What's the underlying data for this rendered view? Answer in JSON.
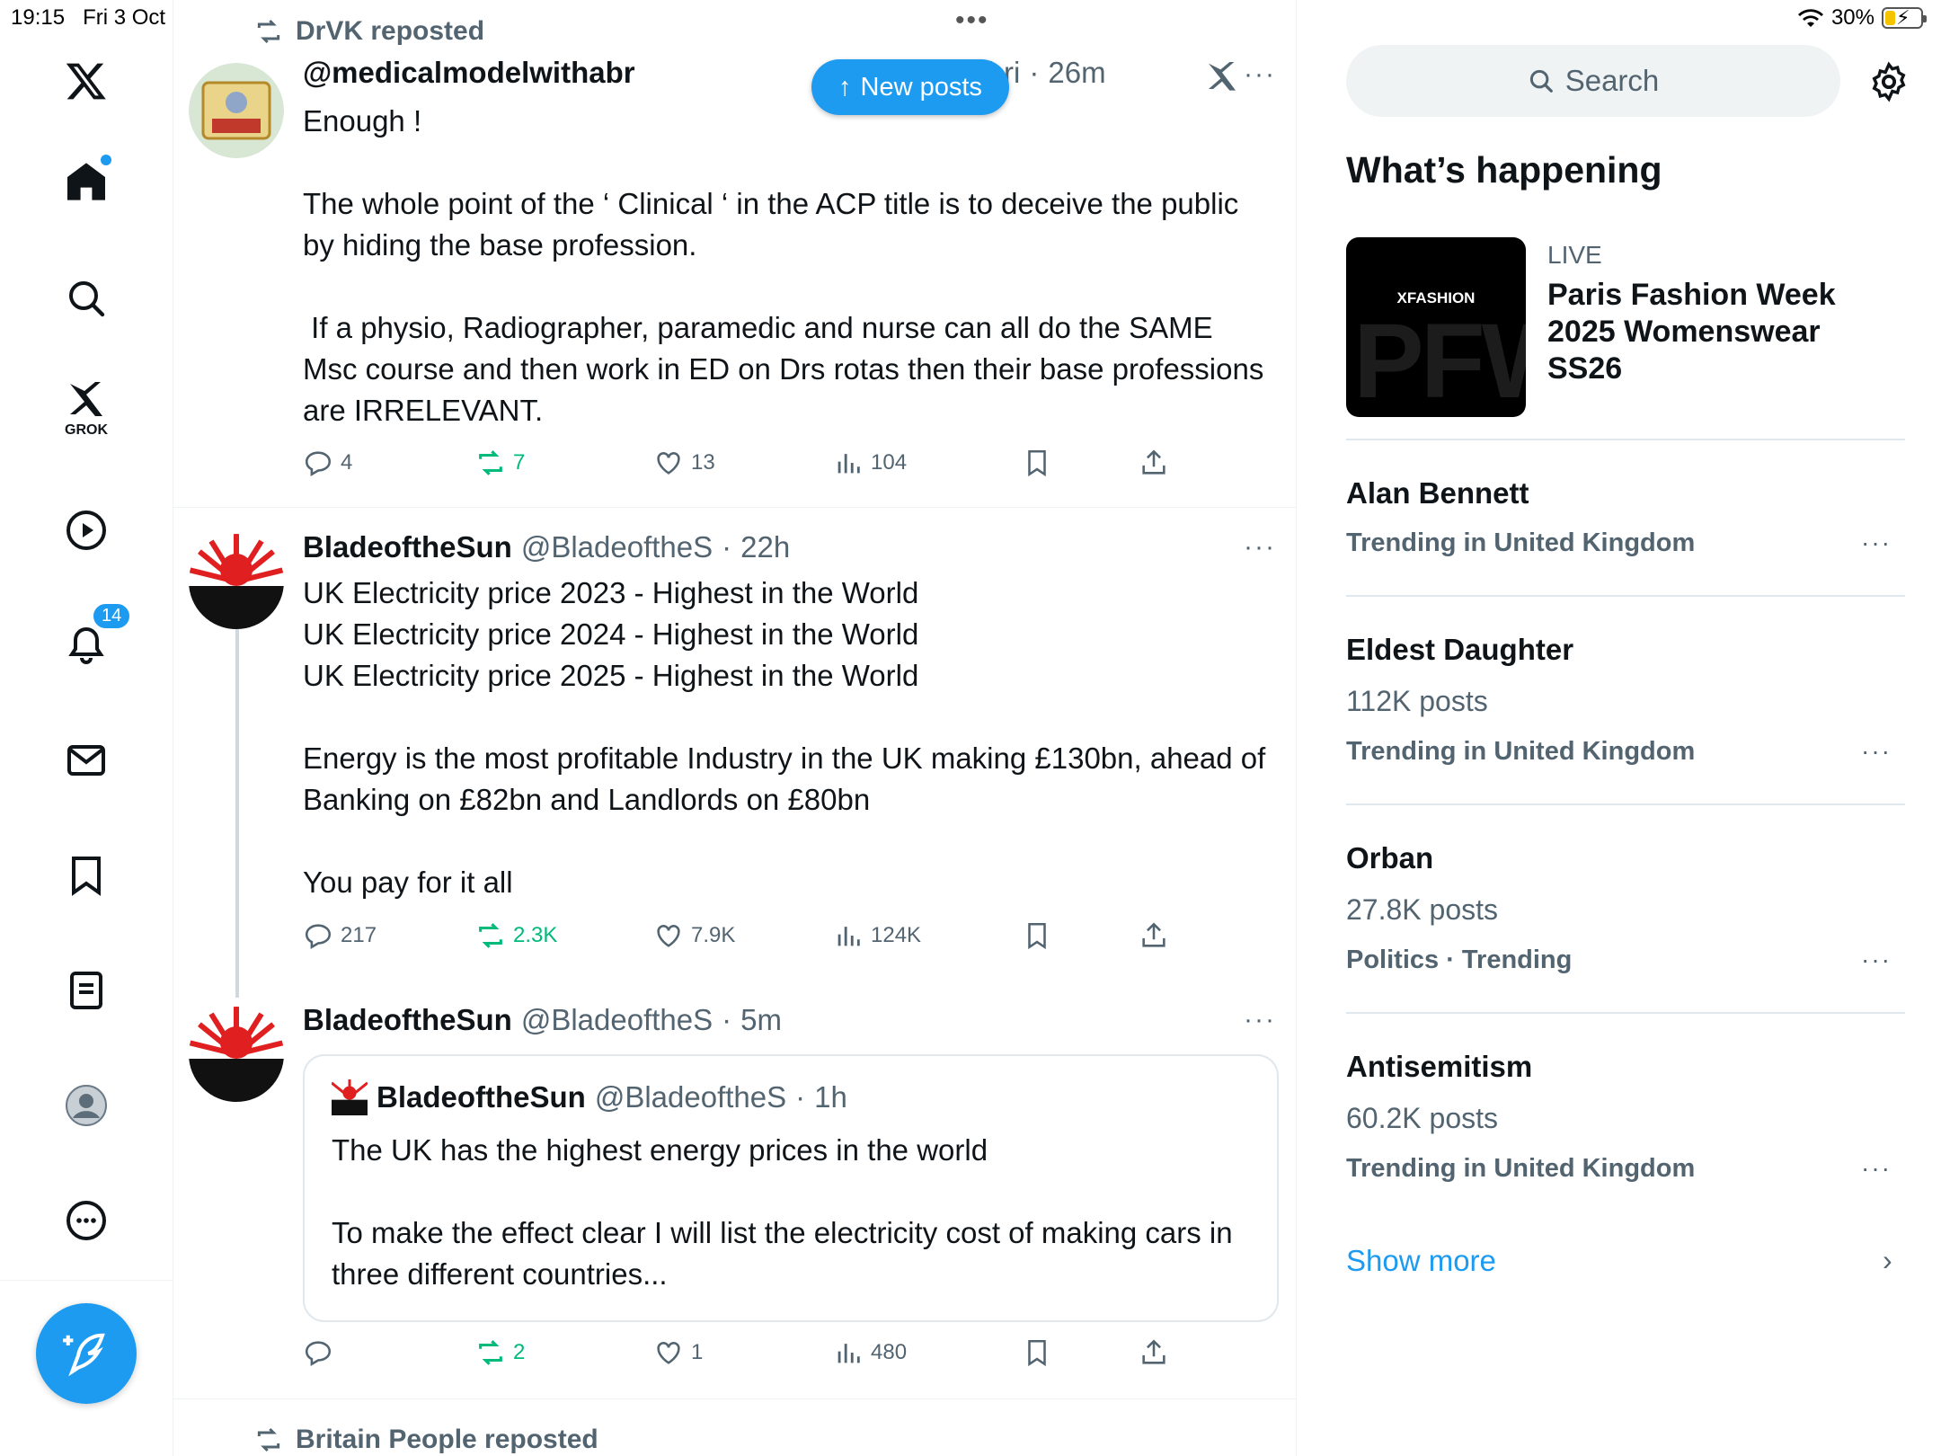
{
  "status": {
    "time": "19:15",
    "date": "Fri 3 Oct",
    "battery": "30%",
    "battery_level": 0.3
  },
  "nav": {
    "grok_label": "GROK",
    "notifications_badge": "14"
  },
  "new_posts_label": "New posts",
  "tweets": [
    {
      "repost_label": "DrVK reposted",
      "name": "@medicalmodelwithabr",
      "handle": "edicalmodelbri",
      "time": "26m",
      "body": "Enough !\n\nThe whole point of the ‘ Clinical ‘ in the ACP title is to deceive the public by hiding the base profession.\n\n If a physio, Radiographer, paramedic and nurse can all do the SAME Msc course and then work in ED on Drs rotas then their base professions are IRRELEVANT.",
      "replies": "4",
      "reposts": "7",
      "likes": "13",
      "views": "104"
    },
    {
      "name": "BladeoftheSun",
      "handle": "@BladeoftheS",
      "time": "22h",
      "body": "UK Electricity price 2023 - Highest in the World\nUK Electricity price 2024 - Highest in the World\nUK Electricity price 2025 - Highest in the World\n\nEnergy is the most profitable Industry in the UK making £130bn, ahead of Banking on £82bn and Landlords on £80bn\n\nYou pay for it all",
      "replies": "217",
      "reposts": "2.3K",
      "likes": "7.9K",
      "views": "124K"
    },
    {
      "name": "BladeoftheSun",
      "handle": "@BladeoftheS",
      "time": "5m",
      "quote": {
        "name": "BladeoftheSun",
        "handle": "@BladeoftheS",
        "time": "1h",
        "body": "The UK has the highest energy prices in the world\n\nTo make the effect clear I will list the electricity cost of making cars in three different countries..."
      },
      "replies": "",
      "reposts": "2",
      "likes": "1",
      "views": "480"
    }
  ],
  "next_repost_label": "Britain People reposted",
  "sidebar": {
    "search_placeholder": "Search",
    "heading": "What’s happening",
    "event": {
      "live_label": "LIVE",
      "title": "Paris Fashion Week 2025 Womenswear SS26",
      "image_brand": "XFASHION",
      "image_text": "PFW"
    },
    "trends": [
      {
        "name": "Alan Bennett",
        "count": "",
        "context": "Trending in United Kingdom"
      },
      {
        "name": "Eldest Daughter",
        "count": "112K posts",
        "context": "Trending in United Kingdom"
      },
      {
        "name": "Orban",
        "count": "27.8K posts",
        "context": "Politics · Trending"
      },
      {
        "name": "Antisemitism",
        "count": "60.2K posts",
        "context": "Trending in United Kingdom"
      }
    ],
    "show_more": "Show more"
  },
  "colors": {
    "accent": "#1d9bf0",
    "repost_green": "#00ba7c",
    "muted": "#536471"
  }
}
